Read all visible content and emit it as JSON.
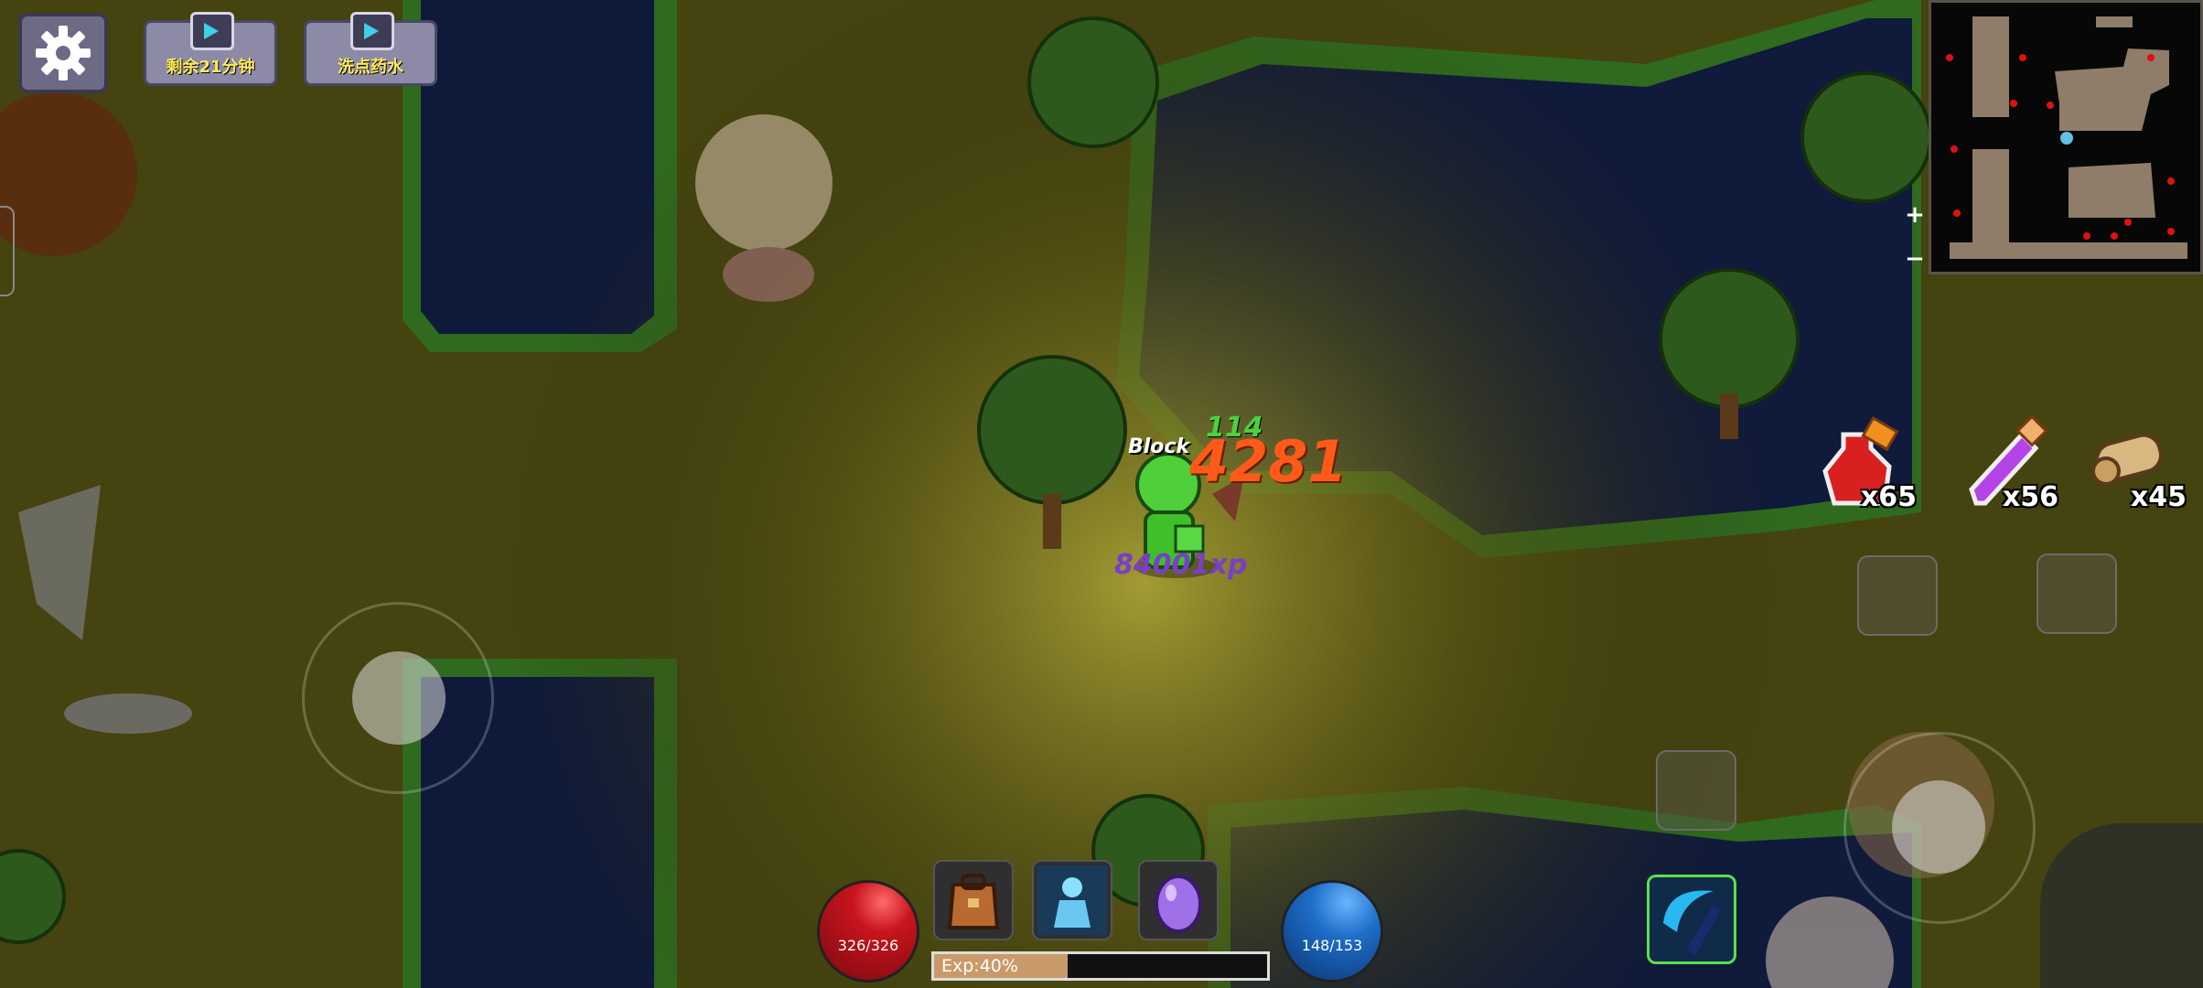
{
  "hud": {
    "ad_buttons": [
      {
        "label": "剩余21分钟",
        "icon": "tv-icon"
      },
      {
        "label": "洗点药水",
        "icon": "tv-icon"
      }
    ],
    "minimap": {
      "zoom_in": "+",
      "zoom_out": "−"
    },
    "consumables": [
      {
        "name": "health-potion",
        "count": "x65"
      },
      {
        "name": "mana-vial",
        "count": "x56"
      },
      {
        "name": "scroll",
        "count": "x45"
      }
    ],
    "hp": {
      "text": "326/326",
      "color": "#c8141c"
    },
    "mp": {
      "text": "148/153",
      "color": "#1e6ec8"
    },
    "exp": {
      "text": "Exp:40%",
      "percent": 40
    },
    "hotbar_icons": [
      "bag-icon",
      "spirit-skill-icon",
      "egg-icon"
    ],
    "skill_icon": "scythe-skill-icon"
  },
  "combat_text": {
    "block": "Block",
    "heal": "114",
    "damage": "4281",
    "exp_gain": "84001xp"
  },
  "colors": {
    "grass": "#4a4a12",
    "water": "#101a3a",
    "shore": "#2f6a1e",
    "damage": "#ff5a1a",
    "heal": "#4cd23c",
    "exp": "#7a3ec8"
  }
}
